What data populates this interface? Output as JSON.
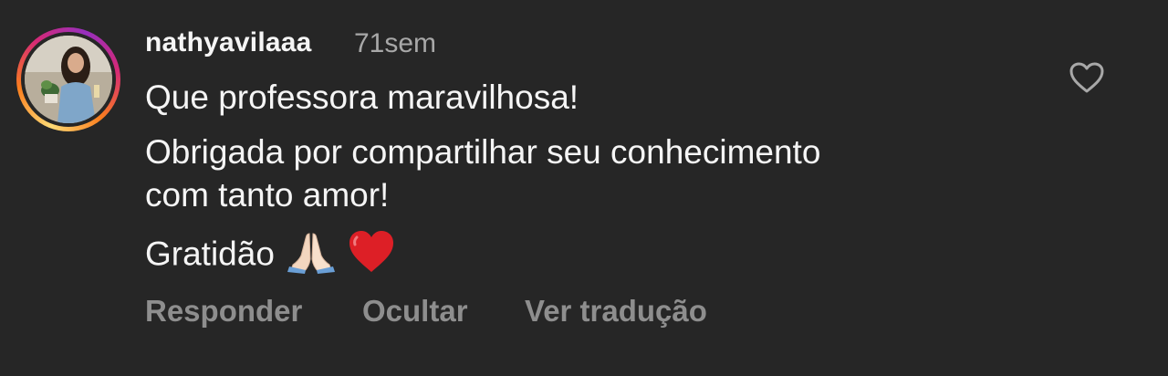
{
  "comment": {
    "username": "nathyavilaaa",
    "time_ago": "71sem",
    "lines": [
      "Que professora maravilhosa!",
      "Obrigada por compartilhar seu conhecimento",
      "com tanto amor!",
      "Gratidão"
    ],
    "emojis": [
      "praying-hands-emoji",
      "red-heart-emoji"
    ],
    "actions": {
      "reply": "Responder",
      "hide": "Ocultar",
      "translate": "Ver tradução"
    },
    "like_icon": "heart-outline-icon"
  },
  "colors": {
    "background": "#262626",
    "primary_text": "#f5f5f5",
    "secondary_text": "#a8a8a8",
    "action_text": "#8e8e8e",
    "story_ring": [
      "#feda75",
      "#fa7e1e",
      "#d62976",
      "#962fbf"
    ]
  }
}
